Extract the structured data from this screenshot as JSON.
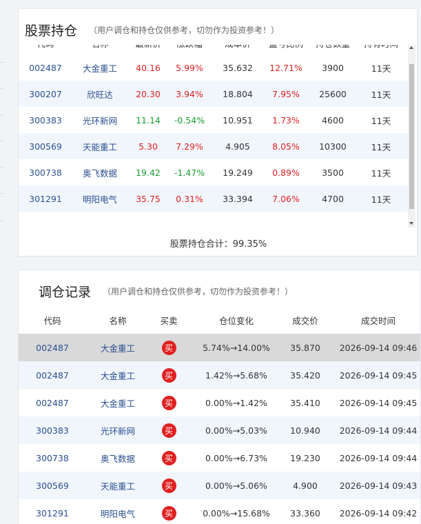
{
  "holdings": {
    "title": "股票持仓",
    "subtitle": "（用户调仓和持仓仅供参考，切勿作为投资参考！）",
    "columns": [
      "代码",
      "名称",
      "最新价",
      "涨跌幅",
      "成本价",
      "盈亏比例",
      "持仓数量",
      "持有时间"
    ],
    "rows": [
      {
        "code": "002487",
        "name": "大金重工",
        "price": "40.16",
        "change": "5.99%",
        "cost": "35.632",
        "pnl": "12.71%",
        "qty": "3900",
        "days": "11天",
        "dir": "up"
      },
      {
        "code": "300207",
        "name": "欣旺达",
        "price": "20.30",
        "change": "3.94%",
        "cost": "18.804",
        "pnl": "7.95%",
        "qty": "25600",
        "days": "11天",
        "dir": "up"
      },
      {
        "code": "300383",
        "name": "光环新网",
        "price": "11.14",
        "change": "-0.54%",
        "cost": "10.951",
        "pnl": "1.73%",
        "qty": "4600",
        "days": "11天",
        "dir": "down"
      },
      {
        "code": "300569",
        "name": "天能重工",
        "price": "5.30",
        "change": "7.29%",
        "cost": "4.905",
        "pnl": "8.05%",
        "qty": "10300",
        "days": "11天",
        "dir": "up"
      },
      {
        "code": "300738",
        "name": "奥飞数据",
        "price": "19.42",
        "change": "-1.47%",
        "cost": "19.249",
        "pnl": "0.89%",
        "qty": "3500",
        "days": "11天",
        "dir": "down"
      },
      {
        "code": "301291",
        "name": "明阳电气",
        "price": "35.75",
        "change": "0.31%",
        "cost": "33.394",
        "pnl": "7.06%",
        "qty": "4700",
        "days": "11天",
        "dir": "up"
      }
    ],
    "total_label": "股票持仓合计：",
    "total_value": "99.35%"
  },
  "trades": {
    "title": "调仓记录",
    "subtitle": "（用户调仓和持仓仅供参考，切勿作为投资参考！）",
    "columns": [
      "代码",
      "名称",
      "买卖",
      "仓位变化",
      "成交价",
      "成交时间"
    ],
    "rows": [
      {
        "code": "002487",
        "name": "大金重工",
        "side": "买",
        "change": "5.74%→14.00%",
        "price": "35.870",
        "time": "2026-09-14 09:46"
      },
      {
        "code": "002487",
        "name": "大金重工",
        "side": "买",
        "change": "1.42%→5.68%",
        "price": "35.420",
        "time": "2026-09-14 09:45"
      },
      {
        "code": "002487",
        "name": "大金重工",
        "side": "买",
        "change": "0.00%→1.42%",
        "price": "35.410",
        "time": "2026-09-14 09:45"
      },
      {
        "code": "300383",
        "name": "光环新网",
        "side": "买",
        "change": "0.00%→5.03%",
        "price": "10.940",
        "time": "2026-09-14 09:44"
      },
      {
        "code": "300738",
        "name": "奥飞数据",
        "side": "买",
        "change": "0.00%→6.73%",
        "price": "19.230",
        "time": "2026-09-14 09:44"
      },
      {
        "code": "300569",
        "name": "天能重工",
        "side": "买",
        "change": "0.00%→5.06%",
        "price": "4.900",
        "time": "2026-09-14 09:43"
      },
      {
        "code": "301291",
        "name": "明阳电气",
        "side": "买",
        "change": "0.00%→15.68%",
        "price": "33.360",
        "time": "2026-09-14 09:42"
      }
    ]
  },
  "colors": {
    "up": "#e02020",
    "down": "#1a9b32",
    "link": "#2a4f8f",
    "row_alt": "#f1f6fd",
    "row_highlight": "#d9d9d9"
  }
}
